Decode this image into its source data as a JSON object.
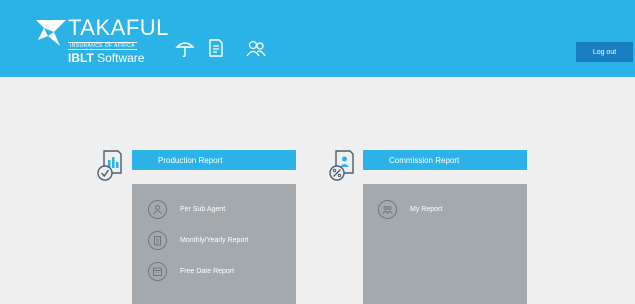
{
  "header": {
    "brand": "TAKAFUL",
    "brand_sub": "INSURANCE OF AFRICA",
    "software_bold": "IBLT",
    "software_rest": " Software",
    "icons": [
      "umbrella-icon",
      "document-icon",
      "users-icon"
    ],
    "logout_label": "Log out"
  },
  "cards": [
    {
      "title": "Production Report",
      "icon": "production-report-icon",
      "items": [
        {
          "label": "Per Sub Agent",
          "icon": "agent-icon"
        },
        {
          "label": "Monthly/Yearly Report",
          "icon": "clipboard-icon"
        },
        {
          "label": "Free Date Report",
          "icon": "calendar-icon"
        }
      ]
    },
    {
      "title": "Commission Report",
      "icon": "commission-report-icon",
      "items": [
        {
          "label": "My Report",
          "icon": "group-icon"
        }
      ]
    }
  ],
  "colors": {
    "header": "#2bb3e8",
    "panel": "#a4a9ad",
    "logout": "#1a7fc1",
    "background": "#efeff0"
  }
}
